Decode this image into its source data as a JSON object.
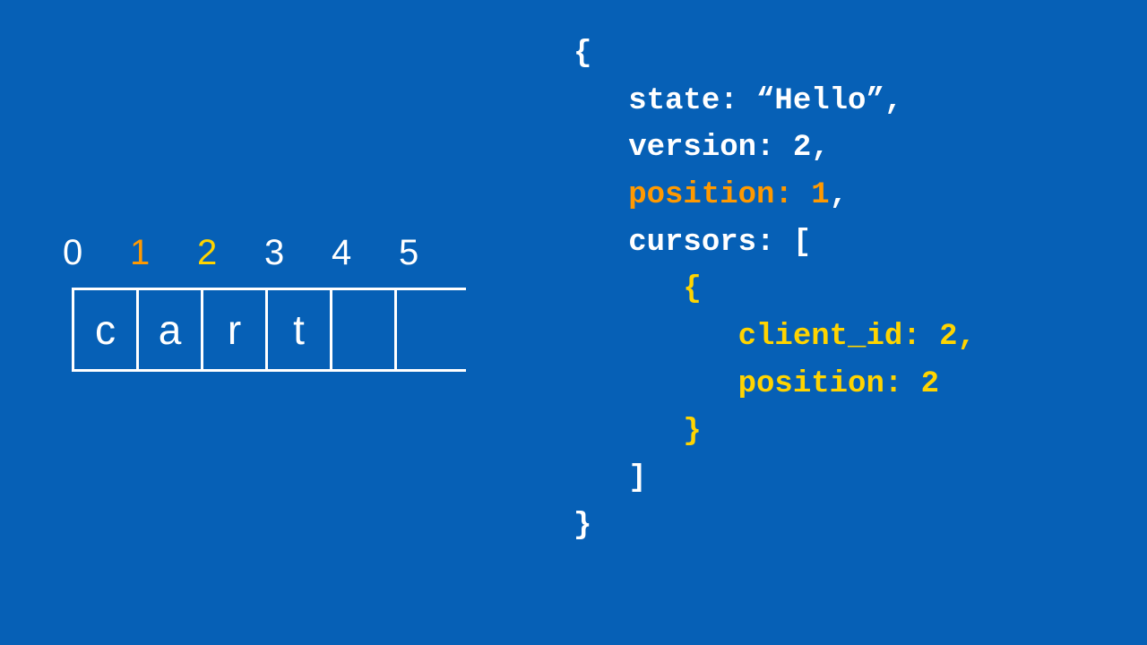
{
  "diagram": {
    "indices": [
      {
        "value": "0",
        "color": "white"
      },
      {
        "value": "1",
        "color": "orange"
      },
      {
        "value": "2",
        "color": "yellow"
      },
      {
        "value": "3",
        "color": "white"
      },
      {
        "value": "4",
        "color": "white"
      },
      {
        "value": "5",
        "color": "white"
      }
    ],
    "cells": [
      "c",
      "a",
      "r",
      "t",
      ""
    ]
  },
  "code": {
    "l0": "{",
    "l1": "   state: “Hello”,",
    "l2": "   version: 2,",
    "l3i": "   ",
    "l3a": "position: 1",
    "l3t": ",",
    "l4": "   cursors: [",
    "l5": "      {",
    "l6": "         client_id: 2,",
    "l7": "         position: 2",
    "l8": "      }",
    "l9": "   ]",
    "l10": "}"
  },
  "colors": {
    "background": "#0660b6",
    "white": "#ffffff",
    "orange": "#ff9900",
    "yellow": "#ffd400"
  }
}
